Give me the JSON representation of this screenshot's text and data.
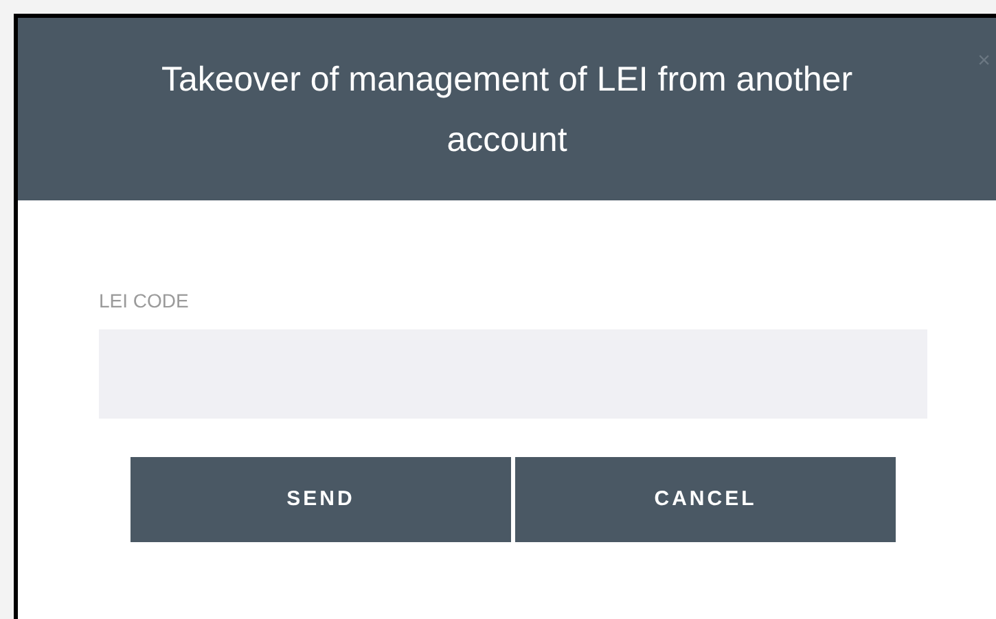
{
  "dialog": {
    "title": "Takeover of management of LEI from another account",
    "close": "×"
  },
  "field": {
    "label": "LEI CODE"
  },
  "buttons": [
    {
      "label": "SEND"
    },
    {
      "label": "CANCEL"
    }
  ]
}
